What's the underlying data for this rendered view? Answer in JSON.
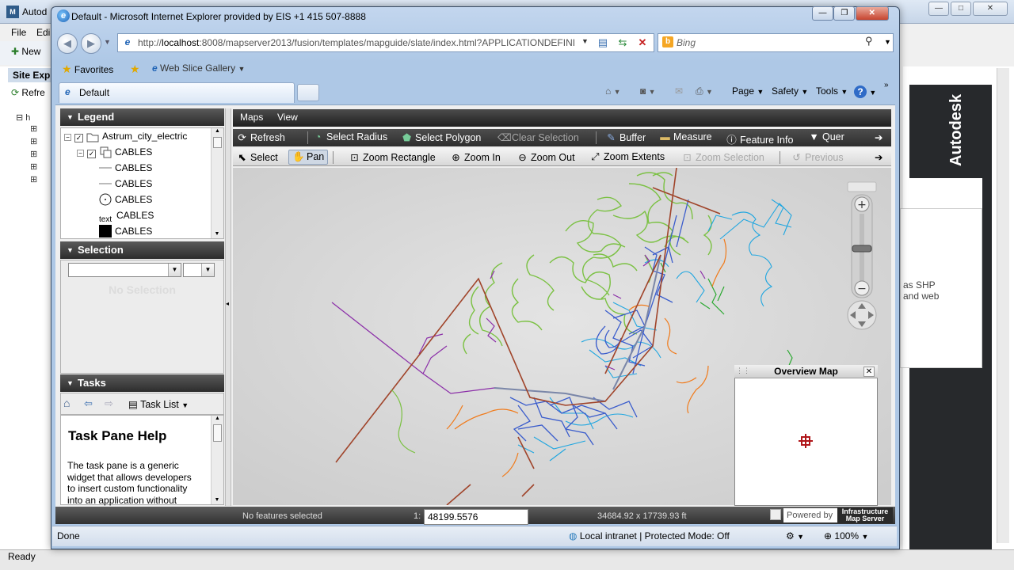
{
  "bg_app": {
    "title": "Autod",
    "logo": "M",
    "menu": [
      "File",
      "Edi"
    ],
    "toolbar_new": "New",
    "site_explorer": "Site Exp",
    "refresh": "Refre",
    "tree_root": "h",
    "status": "Ready",
    "right_brand": "Autodesk",
    "right_text_1": "as SHP",
    "right_text_2": "and web"
  },
  "ie": {
    "title": "Default - Microsoft Internet Explorer provided by EIS +1 415 507-8888",
    "address_prefix": "http://",
    "address_host": "localhost",
    "address_rest": ":8008/mapserver2013/fusion/templates/mapguide/slate/index.html?APPLICATIONDEFINI",
    "search_placeholder": "Bing",
    "favorites": "Favorites",
    "web_slice_gallery": "Web Slice Gallery",
    "tab_title": "Default",
    "cmd_page": "Page",
    "cmd_safety": "Safety",
    "cmd_tools": "Tools",
    "status_done": "Done",
    "status_zone": "Local intranet | Protected Mode: Off",
    "zoom": "100%"
  },
  "legend": {
    "title": "Legend",
    "items": [
      {
        "label": "Astrum_city_electric",
        "symbol": "folder-icon"
      },
      {
        "label": "CABLES",
        "symbol": "layer-group-icon"
      },
      {
        "label": "CABLES",
        "symbol": "line-symbol"
      },
      {
        "label": "CABLES",
        "symbol": "line-symbol"
      },
      {
        "label": "CABLES",
        "symbol": "circle-symbol"
      },
      {
        "label": "CABLES",
        "symbol": "text-symbol"
      },
      {
        "label": "CABLES",
        "symbol": "fill-symbol"
      }
    ],
    "text_symbol": "text"
  },
  "selection": {
    "title": "Selection",
    "empty_text": "No Selection"
  },
  "tasks": {
    "title": "Tasks",
    "task_list": "Task List",
    "help_title": "Task Pane Help",
    "help_body": "The task pane is a generic widget that allows developers to insert custom functionality into an application without"
  },
  "map_menu": [
    "Maps",
    "View"
  ],
  "toolbar1": {
    "refresh": "Refresh",
    "select_radius": "Select Radius",
    "select_polygon": "Select Polygon",
    "clear_selection": "Clear Selection",
    "buffer": "Buffer",
    "measure": "Measure",
    "feature_info": "Feature Info",
    "query": "Quer"
  },
  "toolbar2": {
    "select": "Select",
    "pan": "Pan",
    "zoom_rectangle": "Zoom Rectangle",
    "zoom_in": "Zoom In",
    "zoom_out": "Zoom Out",
    "zoom_extents": "Zoom Extents",
    "zoom_selection": "Zoom Selection",
    "previous": "Previous"
  },
  "overview": {
    "title": "Overview Map"
  },
  "map_status": {
    "features": "No features selected",
    "scale_prefix": "1:",
    "scale": "48199.5576",
    "extent": "34684.92 x 17739.93 ft",
    "powered_by": "Powered by",
    "brand_line1": "Infrastructure",
    "brand_line2": "Map Server"
  },
  "colors": {
    "roads_green": "#7bc143",
    "cables_blue": "#3a5ccc",
    "cables_cyan": "#1fa6e0",
    "lines_purple": "#8b2ea8",
    "lines_orange": "#f07a1a",
    "lines_brown": "#a0442a"
  }
}
